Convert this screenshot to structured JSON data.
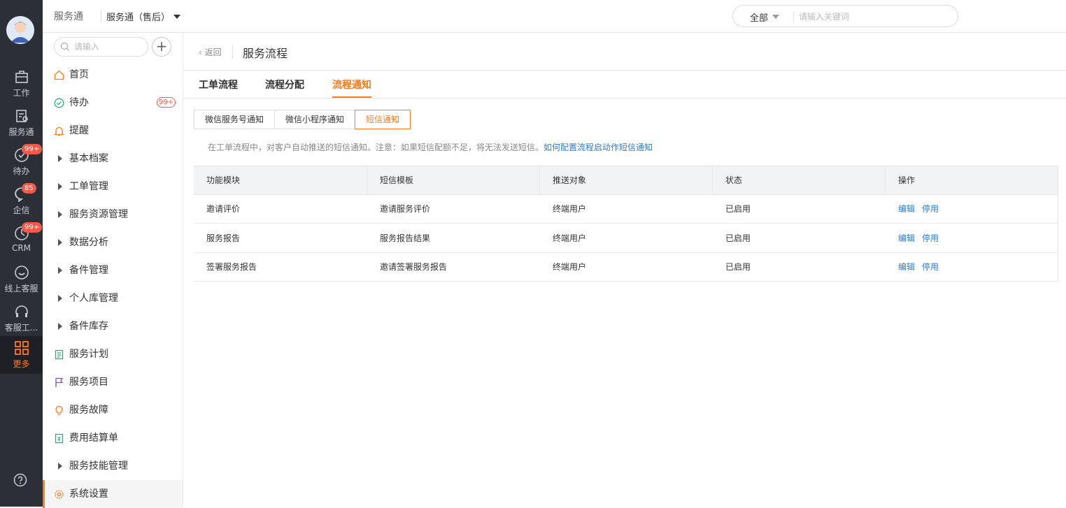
{
  "rail": {
    "items": [
      {
        "label": "工作",
        "icon": "briefcase-icon"
      },
      {
        "label": "服务通",
        "icon": "service-icon"
      },
      {
        "label": "待办",
        "icon": "check-circle-icon",
        "badge": "99+"
      },
      {
        "label": "企信",
        "icon": "chat-icon",
        "badge": "85"
      },
      {
        "label": "CRM",
        "icon": "crm-icon",
        "badge": "99+"
      },
      {
        "label": "线上客服",
        "icon": "smile-icon"
      },
      {
        "label": "客服工...",
        "icon": "headset-icon"
      },
      {
        "label": "更多",
        "icon": "grid-icon"
      }
    ]
  },
  "topbar": {
    "brand": "服务通",
    "selector": "服务通（售后）",
    "search_scope": "全部",
    "search_placeholder": "请输入关键词"
  },
  "menu": {
    "search_placeholder": "请输入",
    "items": [
      {
        "label": "首页",
        "icon": "home-icon"
      },
      {
        "label": "待办",
        "icon": "check-circle-icon",
        "badge": "99+"
      },
      {
        "label": "提醒",
        "icon": "bell-icon"
      },
      {
        "label": "基本档案",
        "icon": "caret-right-icon"
      },
      {
        "label": "工单管理",
        "icon": "caret-right-icon"
      },
      {
        "label": "服务资源管理",
        "icon": "caret-right-icon"
      },
      {
        "label": "数据分析",
        "icon": "caret-right-icon"
      },
      {
        "label": "备件管理",
        "icon": "caret-right-icon"
      },
      {
        "label": "个人库管理",
        "icon": "caret-right-icon"
      },
      {
        "label": "备件库存",
        "icon": "caret-right-icon"
      },
      {
        "label": "服务计划",
        "icon": "plan-icon"
      },
      {
        "label": "服务项目",
        "icon": "flag-icon"
      },
      {
        "label": "服务故障",
        "icon": "bulb-icon"
      },
      {
        "label": "费用结算单",
        "icon": "bill-icon"
      },
      {
        "label": "服务技能管理",
        "icon": "caret-right-icon"
      },
      {
        "label": "系统设置",
        "icon": "gear-icon"
      }
    ]
  },
  "content": {
    "back": "返回",
    "title": "服务流程",
    "tabs": [
      "工单流程",
      "流程分配",
      "流程通知"
    ],
    "subtabs": [
      "微信服务号通知",
      "微信小程序通知",
      "短信通知"
    ],
    "tip": "在工单流程中，对客户自动推送的短信通知。注意：如果短信配额不足，将无法发送短信。",
    "tip_link": "如何配置流程启动作短信通知",
    "table": {
      "headers": [
        "功能模块",
        "短信模板",
        "推送对象",
        "状态",
        "操作"
      ],
      "rows": [
        {
          "module": "邀请评价",
          "template": "邀请服务评价",
          "target": "终端用户",
          "status": "已启用",
          "edit": "编辑",
          "disable": "停用"
        },
        {
          "module": "服务报告",
          "template": "服务报告结果",
          "target": "终端用户",
          "status": "已启用",
          "edit": "编辑",
          "disable": "停用"
        },
        {
          "module": "签署服务报告",
          "template": "邀请签署服务报告",
          "target": "终端用户",
          "status": "已启用",
          "edit": "编辑",
          "disable": "停用"
        }
      ]
    }
  }
}
